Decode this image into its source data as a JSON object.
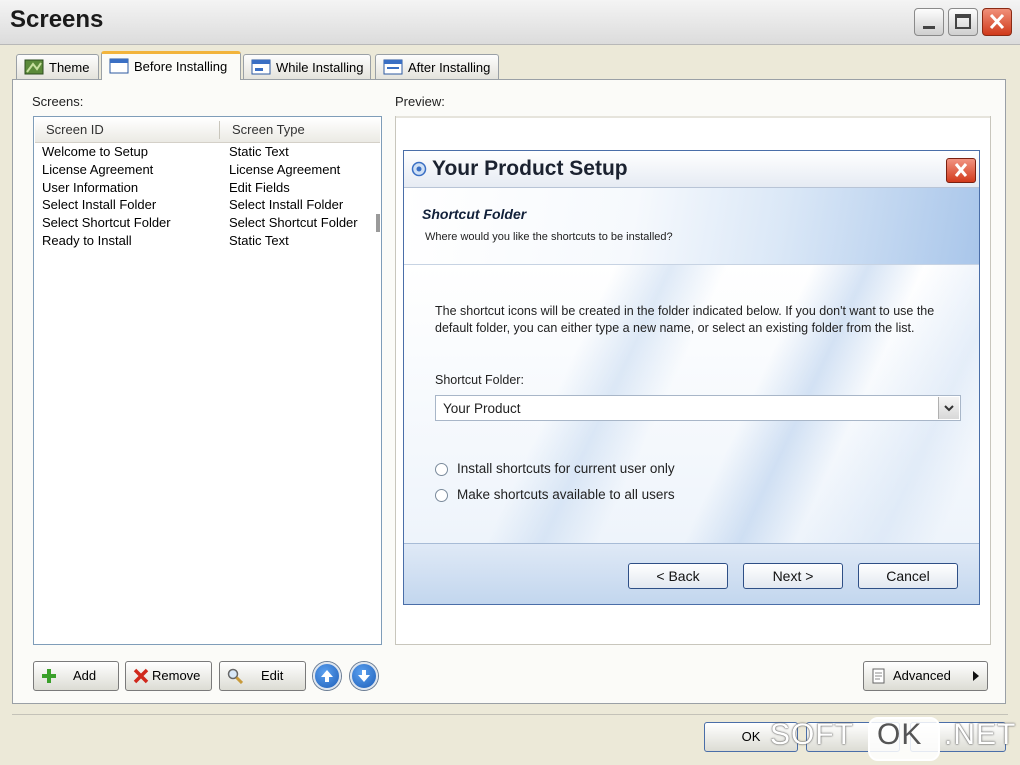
{
  "window": {
    "title": "Screens"
  },
  "tabs": [
    {
      "label": "Theme",
      "icon": "theme-icon",
      "active": false
    },
    {
      "label": "Before Installing",
      "icon": "window-icon",
      "active": true
    },
    {
      "label": "While Installing",
      "icon": "window-progress-icon",
      "active": false
    },
    {
      "label": "After Installing",
      "icon": "window-done-icon",
      "active": false
    }
  ],
  "screens_label": "Screens:",
  "preview_label": "Preview:",
  "list": {
    "columns": [
      "Screen ID",
      "Screen Type"
    ],
    "rows": [
      [
        "Welcome to Setup",
        "Static Text"
      ],
      [
        "License Agreement",
        "License Agreement"
      ],
      [
        "User Information",
        "Edit Fields"
      ],
      [
        "Select Install Folder",
        "Select Install Folder"
      ],
      [
        "Select Shortcut Folder",
        "Select Shortcut Folder"
      ],
      [
        "Ready to Install",
        "Static Text"
      ]
    ]
  },
  "preview": {
    "title": "Your Product Setup",
    "heading": "Shortcut Folder",
    "subheading": "Where would you like the shortcuts to be installed?",
    "description": "The shortcut icons will be created in the folder indicated below. If you don't want to use the default folder, you can either type a new name, or select an existing folder from the list.",
    "folder_label": "Shortcut Folder:",
    "folder_value": "Your Product",
    "radio_current": "Install shortcuts for current user only",
    "radio_all": "Make shortcuts available to all users",
    "back_label": "< Back",
    "next_label": "Next >",
    "cancel_label": "Cancel"
  },
  "toolbar": {
    "add_label": "Add",
    "remove_label": "Remove",
    "edit_label": "Edit",
    "advanced_label": "Advanced"
  },
  "footer": {
    "ok_label": "OK"
  },
  "watermark": {
    "left": "SOFT",
    "mid": "OK",
    "right": ".NET"
  }
}
